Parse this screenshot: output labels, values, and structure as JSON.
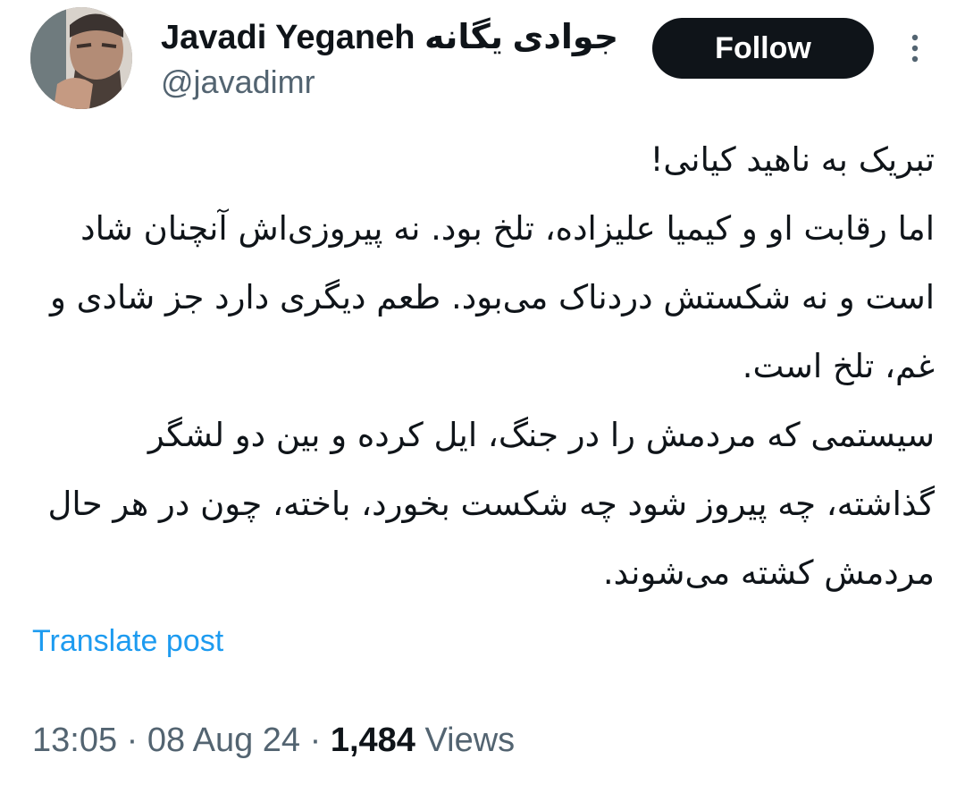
{
  "user": {
    "display_name": "Javadi Yeganeh جوادی یگانه",
    "handle": "@javadimr"
  },
  "actions": {
    "follow_label": "Follow"
  },
  "tweet": {
    "text": "تبریک به ناهید کیانی!\nاما رقابت او و کیمیا علیزاده، تلخ بود. نه پیروزی‌اش آنچنان شاد است و نه شکستش دردناک می‌بود. طعم دیگری دارد جز شادی و غم، تلخ است.\nسیستمی که مردمش را در جنگ، ایل کرده و بین دو لشگر گذاشته، چه پیروز شود چه شکست بخورد، باخته، چون در هر حال مردمش کشته می‌شوند.",
    "translate_label": "Translate post"
  },
  "meta": {
    "time": "13:05",
    "separator": " · ",
    "date": "08 Aug 24",
    "views_count": "1,484",
    "views_label": " Views"
  },
  "icons": {
    "more": "more-vertical-icon"
  },
  "colors": {
    "link": "#1d9bf0",
    "secondary_text": "#536471",
    "primary_text": "#0f1419",
    "follow_bg": "#0f1419"
  }
}
